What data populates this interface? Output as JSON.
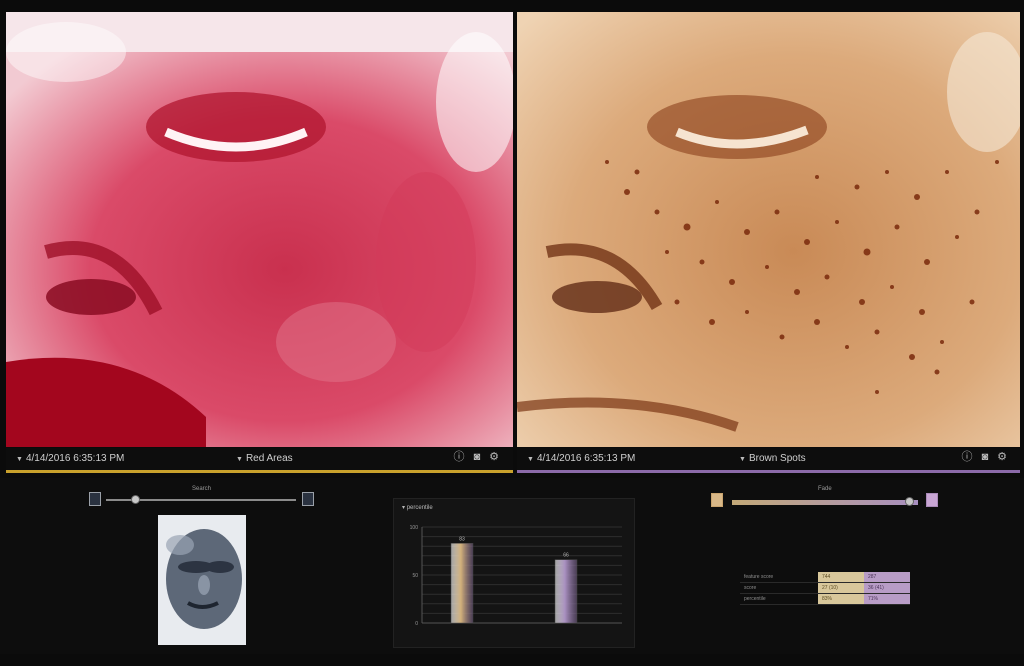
{
  "left_pane": {
    "date": "4/14/2016 6:35:13 PM",
    "mode": "Red Areas",
    "accent": "#c9a12c"
  },
  "right_pane": {
    "date": "4/14/2016 6:35:13 PM",
    "mode": "Brown Spots",
    "accent": "#8b6aa8"
  },
  "icons": {
    "pane_tools": [
      "info-icon",
      "camera-icon",
      "settings-icon"
    ],
    "caret": "caret-down-icon"
  },
  "bottom_left": {
    "slider_label": "Search",
    "slider_level": 0.15
  },
  "bottom_right": {
    "slider_label": "Fade",
    "slider_level": 0.95
  },
  "chart_data": {
    "type": "bar",
    "title": "percentile",
    "categories": [
      "",
      ""
    ],
    "values": [
      83,
      66
    ],
    "bar_labels": [
      "83",
      "66"
    ],
    "ylim": [
      0,
      100
    ],
    "yticks": [
      0,
      50,
      100
    ],
    "colors": [
      "#d2b07a",
      "#a990c0"
    ],
    "grid": true
  },
  "legend_table": {
    "rows": [
      {
        "name": "feature score",
        "a": "744",
        "b": "287"
      },
      {
        "name": "score",
        "a": "27 (10)",
        "b": "36 (41)"
      },
      {
        "name": "percentile",
        "a": "83%",
        "b": "71%"
      }
    ]
  }
}
